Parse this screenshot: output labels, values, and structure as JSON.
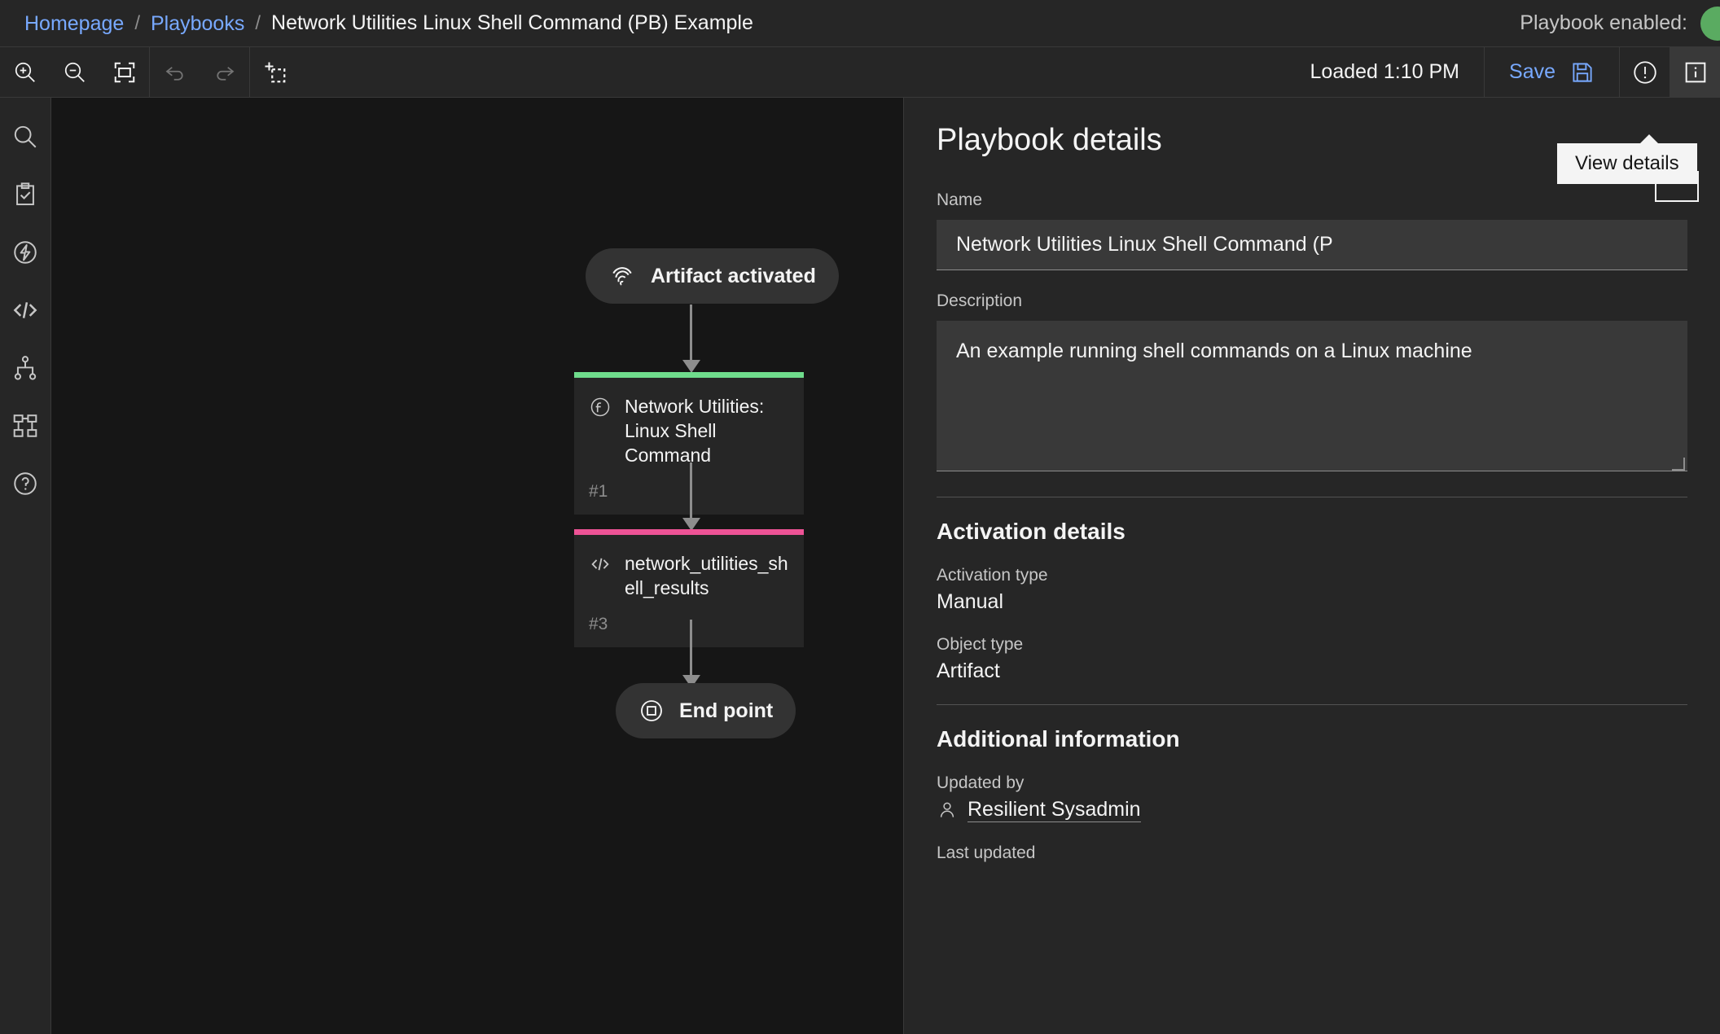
{
  "breadcrumb": {
    "home": "Homepage",
    "section": "Playbooks",
    "separator": "/",
    "current": "Network Utilities Linux Shell Command (PB) Example"
  },
  "header": {
    "enabled_label": "Playbook enabled:",
    "enabled_state": "on",
    "toggle_color": "#5aab61"
  },
  "toolbar": {
    "zoom_in": "zoom-in",
    "zoom_out": "zoom-out",
    "fit_screen": "fit-to-screen",
    "undo": "undo",
    "redo": "redo",
    "marquee": "marquee-select",
    "loaded_text": "Loaded 1:10 PM",
    "save_label": "Save",
    "save_color": "#78a9ff",
    "warning": "warning-icon",
    "view_details": "view-details-icon"
  },
  "tooltip": {
    "text": "View details"
  },
  "rail": {
    "items": [
      {
        "icon": "search-icon",
        "name": "search"
      },
      {
        "icon": "clipboard-check-icon",
        "name": "tasks"
      },
      {
        "icon": "lightning-circle-icon",
        "name": "functions"
      },
      {
        "icon": "code-icon",
        "name": "scripts"
      },
      {
        "icon": "hierarchy-icon",
        "name": "decisions"
      },
      {
        "icon": "sitemap-icon",
        "name": "subplaybooks"
      },
      {
        "icon": "help-circle-icon",
        "name": "help"
      }
    ]
  },
  "canvas": {
    "nodes": [
      {
        "type": "start",
        "label": "Artifact activated",
        "icon": "fingerprint-icon"
      },
      {
        "type": "function",
        "title": "Network Utilities: Linux Shell Command",
        "id": "#1",
        "icon": "function-icon",
        "accent": "#6fdc8c"
      },
      {
        "type": "script",
        "title": "network_utilities_shell_results",
        "id": "#3",
        "icon": "code-icon",
        "accent": "#ee5396"
      },
      {
        "type": "end",
        "label": "End point",
        "icon": "endpoint-icon"
      }
    ],
    "edge_color": "#8d8d8d"
  },
  "details": {
    "title": "Playbook details",
    "name_label": "Name",
    "name_value": "Network Utilities Linux Shell Command (P",
    "description_label": "Description",
    "description_value": "An example running shell commands on a Linux machine",
    "activation_section": "Activation details",
    "activation_type_label": "Activation type",
    "activation_type_value": "Manual",
    "object_type_label": "Object type",
    "object_type_value": "Artifact",
    "additional_section": "Additional information",
    "updated_by_label": "Updated by",
    "updated_by_value": "Resilient Sysadmin",
    "last_updated_label": "Last updated"
  }
}
